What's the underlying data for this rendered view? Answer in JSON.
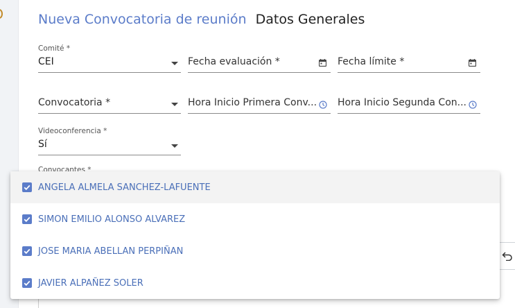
{
  "header": {
    "title": "Nueva Convocatoria de reunión",
    "subtitle": "Datos Generales"
  },
  "form": {
    "comite": {
      "label": "Comité *",
      "value": "CEI"
    },
    "fecha_evaluacion": {
      "placeholder": "Fecha evaluación *"
    },
    "fecha_limite": {
      "placeholder": "Fecha límite *"
    },
    "convocatoria": {
      "placeholder": "Convocatoria *"
    },
    "hora_inicio_primera": {
      "placeholder": "Hora Inicio Primera Conv..."
    },
    "hora_inicio_segunda": {
      "placeholder": "Hora Inicio Segunda Con..."
    },
    "videoconferencia": {
      "label": "Videoconferencia *",
      "value": "Sí"
    },
    "convocantes": {
      "label": "Convocantes *"
    }
  },
  "convocantes_options": [
    {
      "label": "ANGELA ALMELA SANCHEZ-LAFUENTE",
      "checked": true
    },
    {
      "label": "SIMON EMILIO ALONSO ALVAREZ",
      "checked": true
    },
    {
      "label": "JOSE MARIA ABELLAN PERPIÑAN",
      "checked": true
    },
    {
      "label": "JAVIER ALPAÑEZ SOLER",
      "checked": true
    }
  ],
  "colors": {
    "accent": "#5b7cc9",
    "option_text": "#4a6fb8",
    "calendar_icon": "#444444",
    "clock_icon": "#5b7cc9"
  },
  "icons": {
    "dropdown": "caret-down-icon",
    "date": "calendar-icon",
    "time": "clock-icon",
    "undo": "undo-icon",
    "checkbox": "checkbox-checked-icon"
  }
}
